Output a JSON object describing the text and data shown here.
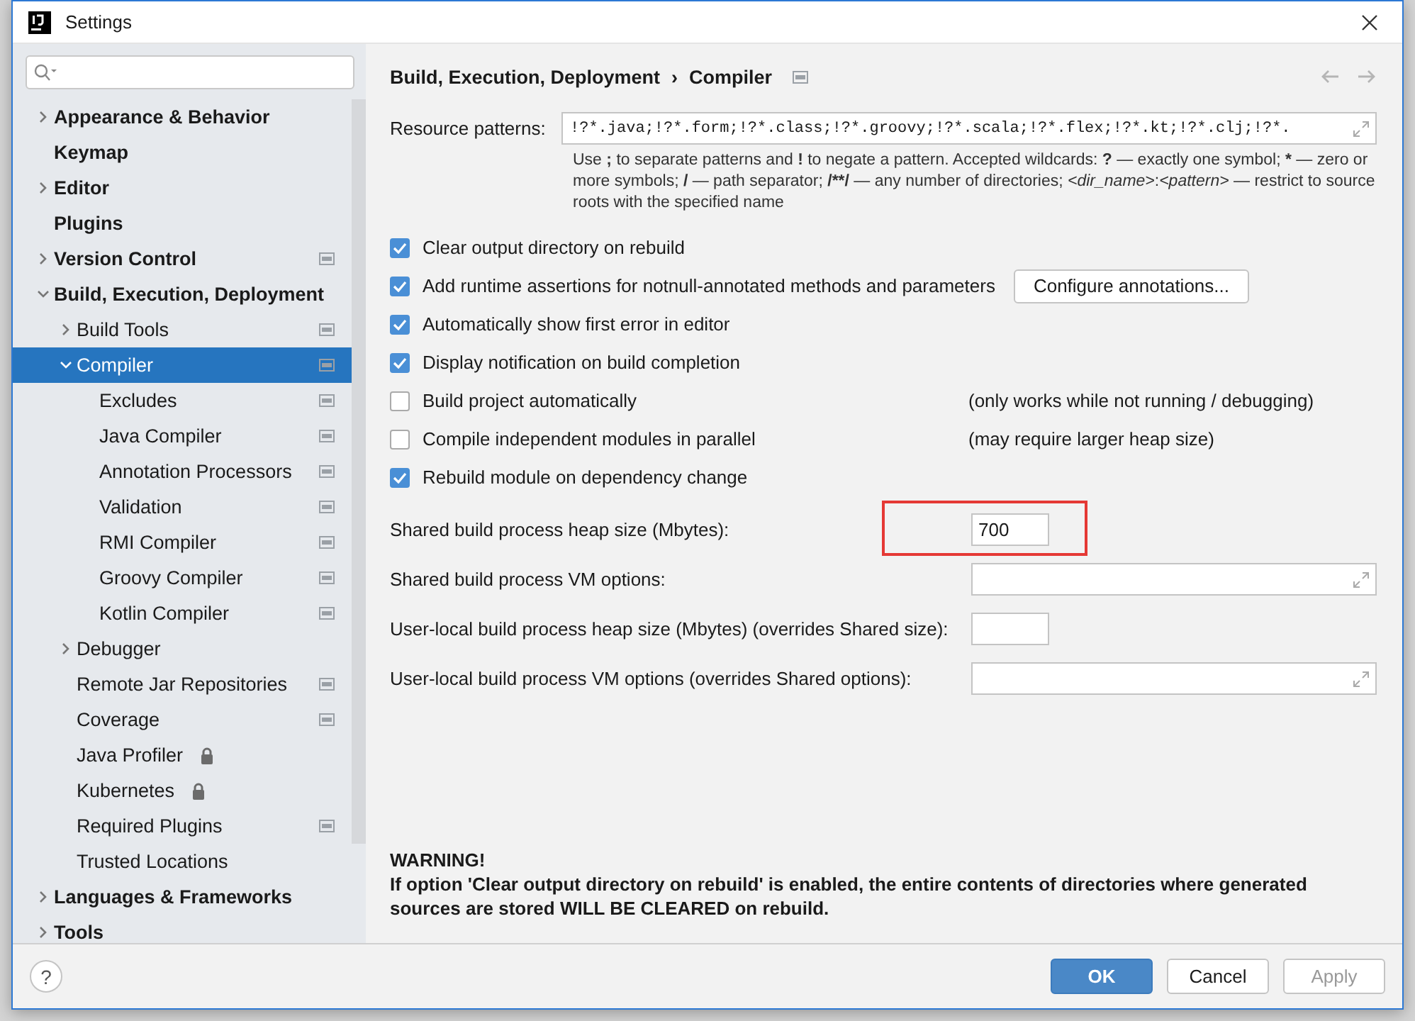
{
  "window": {
    "title": "Settings"
  },
  "sidebar": {
    "items": [
      {
        "label": "Appearance & Behavior",
        "expanded": false,
        "selected": false
      },
      {
        "label": "Keymap",
        "selected": false
      },
      {
        "label": "Editor",
        "expanded": false,
        "selected": false
      },
      {
        "label": "Plugins",
        "selected": false
      },
      {
        "label": "Version Control",
        "expanded": false,
        "selected": false,
        "project_level": true
      },
      {
        "label": "Build, Execution, Deployment",
        "expanded": true,
        "selected": false,
        "children": [
          {
            "label": "Build Tools",
            "expanded": false,
            "selected": false,
            "project_level": true
          },
          {
            "label": "Compiler",
            "expanded": true,
            "selected": true,
            "project_level": true,
            "children": [
              {
                "label": "Excludes",
                "selected": false,
                "project_level": true
              },
              {
                "label": "Java Compiler",
                "selected": false,
                "project_level": true
              },
              {
                "label": "Annotation Processors",
                "selected": false,
                "project_level": true
              },
              {
                "label": "Validation",
                "selected": false,
                "project_level": true
              },
              {
                "label": "RMI Compiler",
                "selected": false,
                "project_level": true
              },
              {
                "label": "Groovy Compiler",
                "selected": false,
                "project_level": true
              },
              {
                "label": "Kotlin Compiler",
                "selected": false,
                "project_level": true
              }
            ]
          },
          {
            "label": "Debugger",
            "expanded": false,
            "selected": false
          },
          {
            "label": "Remote Jar Repositories",
            "selected": false,
            "project_level": true
          },
          {
            "label": "Coverage",
            "selected": false,
            "project_level": true
          },
          {
            "label": "Java Profiler",
            "selected": false,
            "locked": true
          },
          {
            "label": "Kubernetes",
            "selected": false,
            "locked": true
          },
          {
            "label": "Required Plugins",
            "selected": false,
            "project_level": true
          },
          {
            "label": "Trusted Locations",
            "selected": false
          }
        ]
      },
      {
        "label": "Languages & Frameworks",
        "expanded": false,
        "selected": false
      },
      {
        "label": "Tools",
        "expanded": false,
        "selected": false
      }
    ]
  },
  "breadcrumb": {
    "parts": [
      "Build, Execution, Deployment",
      "›",
      "Compiler"
    ]
  },
  "resource_patterns": {
    "label": "Resource patterns:",
    "value": "!?*.java;!?*.form;!?*.class;!?*.groovy;!?*.scala;!?*.flex;!?*.kt;!?*.clj;!?*.",
    "help": [
      {
        "kind": "plain",
        "text": "Use "
      },
      {
        "kind": "bold",
        "text": ";"
      },
      {
        "kind": "plain",
        "text": " to separate patterns and "
      },
      {
        "kind": "bold",
        "text": "!"
      },
      {
        "kind": "plain",
        "text": " to negate a pattern. Accepted wildcards: "
      },
      {
        "kind": "bold",
        "text": "?"
      },
      {
        "kind": "plain",
        "text": " — exactly one symbol; "
      },
      {
        "kind": "bold",
        "text": "*"
      },
      {
        "kind": "plain",
        "text": " — zero or more symbols; "
      },
      {
        "kind": "bold",
        "text": "/"
      },
      {
        "kind": "plain",
        "text": " — path separator; "
      },
      {
        "kind": "bold",
        "text": "/**/"
      },
      {
        "kind": "plain",
        "text": " — any number of directories; "
      },
      {
        "kind": "italic",
        "text": "<dir_name>"
      },
      {
        "kind": "plain",
        "text": ":"
      },
      {
        "kind": "italic",
        "text": "<pattern>"
      },
      {
        "kind": "plain",
        "text": " — restrict to source roots with the specified name"
      }
    ]
  },
  "options": [
    {
      "label": "Clear output directory on rebuild",
      "checked": true
    },
    {
      "label": "Add runtime assertions for notnull-annotated methods and parameters",
      "checked": true,
      "button": "Configure annotations..."
    },
    {
      "label": "Automatically show first error in editor",
      "checked": true
    },
    {
      "label": "Display notification on build completion",
      "checked": true
    },
    {
      "label": "Build project automatically",
      "checked": false,
      "note": "(only works while not running / debugging)"
    },
    {
      "label": "Compile independent modules in parallel",
      "checked": false,
      "note": "(may require larger heap size)"
    },
    {
      "label": "Rebuild module on dependency change",
      "checked": true
    }
  ],
  "fields": [
    {
      "label": "Shared build process heap size (Mbytes):",
      "kind": "short",
      "value": "700",
      "highlighted": true
    },
    {
      "label": "Shared build process VM options:",
      "kind": "wide",
      "highlighted": false
    },
    {
      "label": "User-local build process heap size (Mbytes) (overrides Shared size):",
      "kind": "short",
      "highlighted": false
    },
    {
      "label": "User-local build process VM options (overrides Shared options):",
      "kind": "wide",
      "highlighted": false
    }
  ],
  "warning": {
    "title": "WARNING!",
    "text": "If option 'Clear output directory on rebuild' is enabled, the entire contents of directories where generated sources are stored WILL BE CLEARED on rebuild."
  },
  "footer": {
    "help": "?",
    "buttons": [
      {
        "label": "OK",
        "kind": "primary",
        "disabled": false
      },
      {
        "label": "Cancel",
        "kind": "normal",
        "disabled": false
      },
      {
        "label": "Apply",
        "kind": "normal",
        "disabled": true
      }
    ]
  }
}
